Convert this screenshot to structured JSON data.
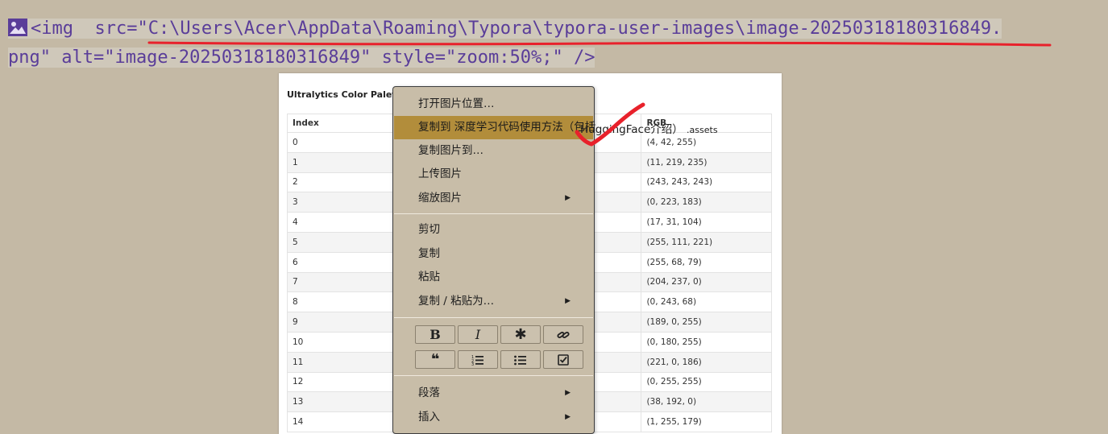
{
  "source": {
    "line1": "<img  src=\"C:\\Users\\Acer\\AppData\\Roaming\\Typora\\typora-user-images\\image-20250318180316849.",
    "line2": "png\" alt=\"image-20250318180316849\" style=\"zoom:50%;\" />"
  },
  "preview": {
    "title": "Ultralytics Color Palette",
    "headers": [
      "Index",
      "",
      "RGB"
    ],
    "rows": [
      {
        "index": "0",
        "rgb": "(4, 42, 255)"
      },
      {
        "index": "1",
        "rgb": "(11, 219, 235)"
      },
      {
        "index": "2",
        "rgb": "(243, 243, 243)"
      },
      {
        "index": "3",
        "rgb": "(0, 223, 183)"
      },
      {
        "index": "4",
        "rgb": "(17, 31, 104)"
      },
      {
        "index": "5",
        "rgb": "(255, 111, 221)"
      },
      {
        "index": "6",
        "rgb": "(255, 68, 79)"
      },
      {
        "index": "7",
        "rgb": "(204, 237, 0)"
      },
      {
        "index": "8",
        "rgb": "(0, 243, 68)"
      },
      {
        "index": "9",
        "rgb": "(189, 0, 255)"
      },
      {
        "index": "10",
        "rgb": "(0, 180, 255)"
      },
      {
        "index": "11",
        "rgb": "(221, 0, 186)"
      },
      {
        "index": "12",
        "rgb": "(0, 255, 255)"
      },
      {
        "index": "13",
        "rgb": "(38, 192, 0)"
      },
      {
        "index": "14",
        "rgb": "(1, 255, 179)"
      }
    ]
  },
  "menu": {
    "open_location": "打开图片位置…",
    "copy_to_label": "复制到 深度学习代码使用方法（包括",
    "copy_to_overflow": "HuggingFace介绍）",
    "copy_to_assets": ".assets",
    "copy_image_to": "复制图片到…",
    "upload_image": "上传图片",
    "zoom_image": "缩放图片",
    "cut": "剪切",
    "copy": "复制",
    "paste": "粘贴",
    "copy_paste_as": "复制 / 粘贴为…",
    "paragraph": "段落",
    "insert": "插入",
    "format_buttons": [
      "bold",
      "italic",
      "asterisk",
      "link",
      "quote",
      "ordered-list",
      "bullet-list",
      "task-list"
    ]
  },
  "colors": {
    "background": "#c4b9a5",
    "source_text": "#5a3d99",
    "menu_bg": "#c8bda8",
    "menu_active": "#b28d3b",
    "annotation_red": "#e8212b"
  }
}
